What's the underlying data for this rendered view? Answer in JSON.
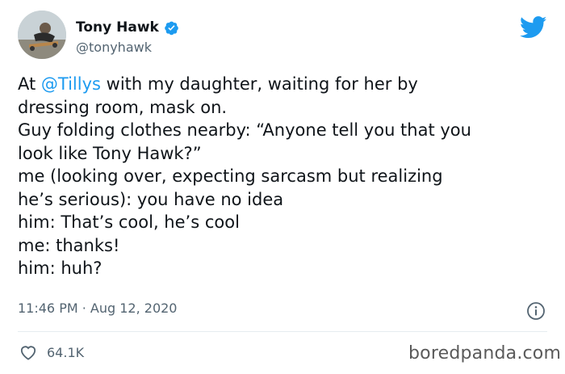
{
  "author": {
    "name": "Tony Hawk",
    "handle": "@tonyhawk"
  },
  "tweet": {
    "line1_prefix": "At ",
    "line1_mention": "@Tillys",
    "line1_suffix": " with my daughter, waiting for her by",
    "line2": "dressing room, mask on.",
    "line3": "Guy folding clothes nearby: “Anyone tell you that you",
    "line4": "look like Tony Hawk?”",
    "line5": "me (looking over, expecting sarcasm but realizing",
    "line6": "he’s serious): you have no idea",
    "line7": "him: That’s cool, he’s cool",
    "line8": "me: thanks!",
    "line9": "him: huh?"
  },
  "meta": {
    "timestamp": "11:46 PM · Aug 12, 2020",
    "likes": "64.1K"
  },
  "watermark": "boredpanda.com",
  "icons": {
    "verified": "verified-badge-icon",
    "bird": "twitter-bird-icon",
    "info": "info-icon",
    "heart": "heart-icon"
  },
  "colors": {
    "link": "#1d9bf0",
    "secondary_text": "#536471",
    "primary_text": "#0f1419"
  }
}
